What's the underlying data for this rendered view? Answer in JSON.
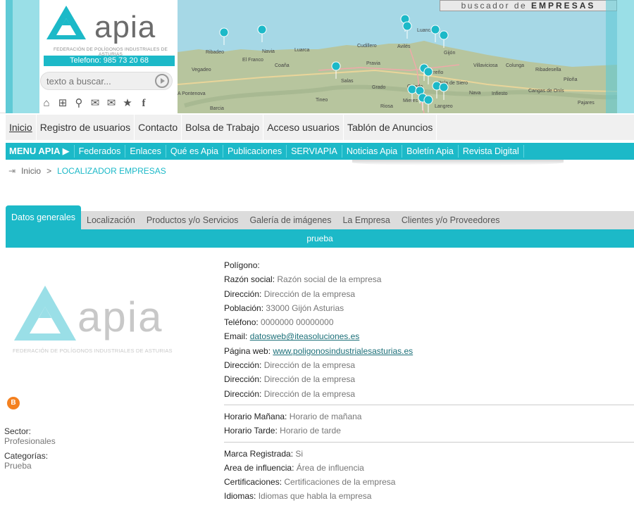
{
  "header": {
    "logo_text": "apia",
    "logo_subtitle": "FEDERACIÓN DE POLÍGONOS INDUSTRIALES DE ASTURIAS",
    "phone": "Telefono: 985 73 20 68",
    "search_placeholder": "texto a buscar...",
    "map_banner_prefix": "buscador de",
    "map_banner_strong": "EMPRESAS",
    "map_places": [
      "Ribadeo",
      "Navia",
      "Luarca",
      "Cudillero",
      "Avilés",
      "Gijón",
      "El Franco",
      "Pravia",
      "Salas",
      "Grado",
      "Oviedo",
      "Vegadeo",
      "Tineo",
      "Villaviciosa",
      "Colunga",
      "Ribadesella",
      "Pola de Siero",
      "Nava",
      "Infiesto",
      "Langreo",
      "Cangas de Onís",
      "Mieres",
      "Barcia",
      "A Pontenova",
      "Pajares",
      "Coaña",
      "Luanco",
      "Carreño",
      "Riosa",
      "Piloña"
    ]
  },
  "top_menu": [
    "Inicio",
    "Registro de usuarios",
    "Contacto",
    "Bolsa de Trabajo",
    "Acceso usuarios",
    "Tablón de Anuncios"
  ],
  "menu2": {
    "brand": "MENU APIA ▶",
    "items": [
      "Federados",
      "Enlaces",
      "Qué es Apia",
      "Publicaciones",
      "SERVIAPIA",
      "Noticias Apia",
      "Boletín Apia",
      "Revista Digital"
    ]
  },
  "breadcrumb": {
    "home": "Inicio",
    "sep": ">",
    "current": "LOCALIZADOR EMPRESAS"
  },
  "tabs": [
    "Datos generales",
    "Localización",
    "Productos y/o Servicios",
    "Galería de imágenes",
    "La Empresa",
    "Clientes y/o Proveedores"
  ],
  "tab_bar_text": "prueba",
  "company": {
    "logo_text": "apia",
    "logo_subtitle": "FEDERACIÓN DE POLÍGONOS INDUSTRIALES DE ASTURIAS",
    "blog_letter": "B",
    "sector_label": "Sector:",
    "sector_value": "Profesionales",
    "categories_label": "Categorías:",
    "categories_value": "Prueba"
  },
  "details": {
    "group1": [
      {
        "label": "Polígono:",
        "value": ""
      },
      {
        "label": "Razón social:",
        "value": "Razón social de la empresa"
      },
      {
        "label": "Dirección:",
        "value": "Dirección de la empresa"
      },
      {
        "label": "Población:",
        "value": "33000 Gijón Asturias"
      },
      {
        "label": "Teléfono:",
        "value": "0000000 00000000"
      },
      {
        "label": "Email:",
        "value": "datosweb@iteasoluciones.es",
        "link": true
      },
      {
        "label": "Página web:",
        "value": "www.poligonosindustrialesasturias.es",
        "link": true
      },
      {
        "label": "Dirección:",
        "value": "Dirección de la empresa"
      },
      {
        "label": "Dirección:",
        "value": "Dirección de la empresa"
      },
      {
        "label": "Dirección:",
        "value": "Dirección de la empresa"
      }
    ],
    "group2": [
      {
        "label": "Horario Mañana:",
        "value": "Horario de mañana"
      },
      {
        "label": "Horario Tarde:",
        "value": "Horario de tarde"
      }
    ],
    "group3": [
      {
        "label": "Marca Registrada:",
        "value": "Si"
      },
      {
        "label": "Area de influencia:",
        "value": "Área de influencia"
      },
      {
        "label": "Certificaciones:",
        "value": "Certificaciones de la empresa"
      },
      {
        "label": "Idiomas:",
        "value": "Idiomas que habla la empresa"
      }
    ]
  },
  "colors": {
    "accent": "#1cb9c8",
    "light_accent": "#9adfe7",
    "sea": "#a6d8e6",
    "land": "#b7c59e"
  }
}
